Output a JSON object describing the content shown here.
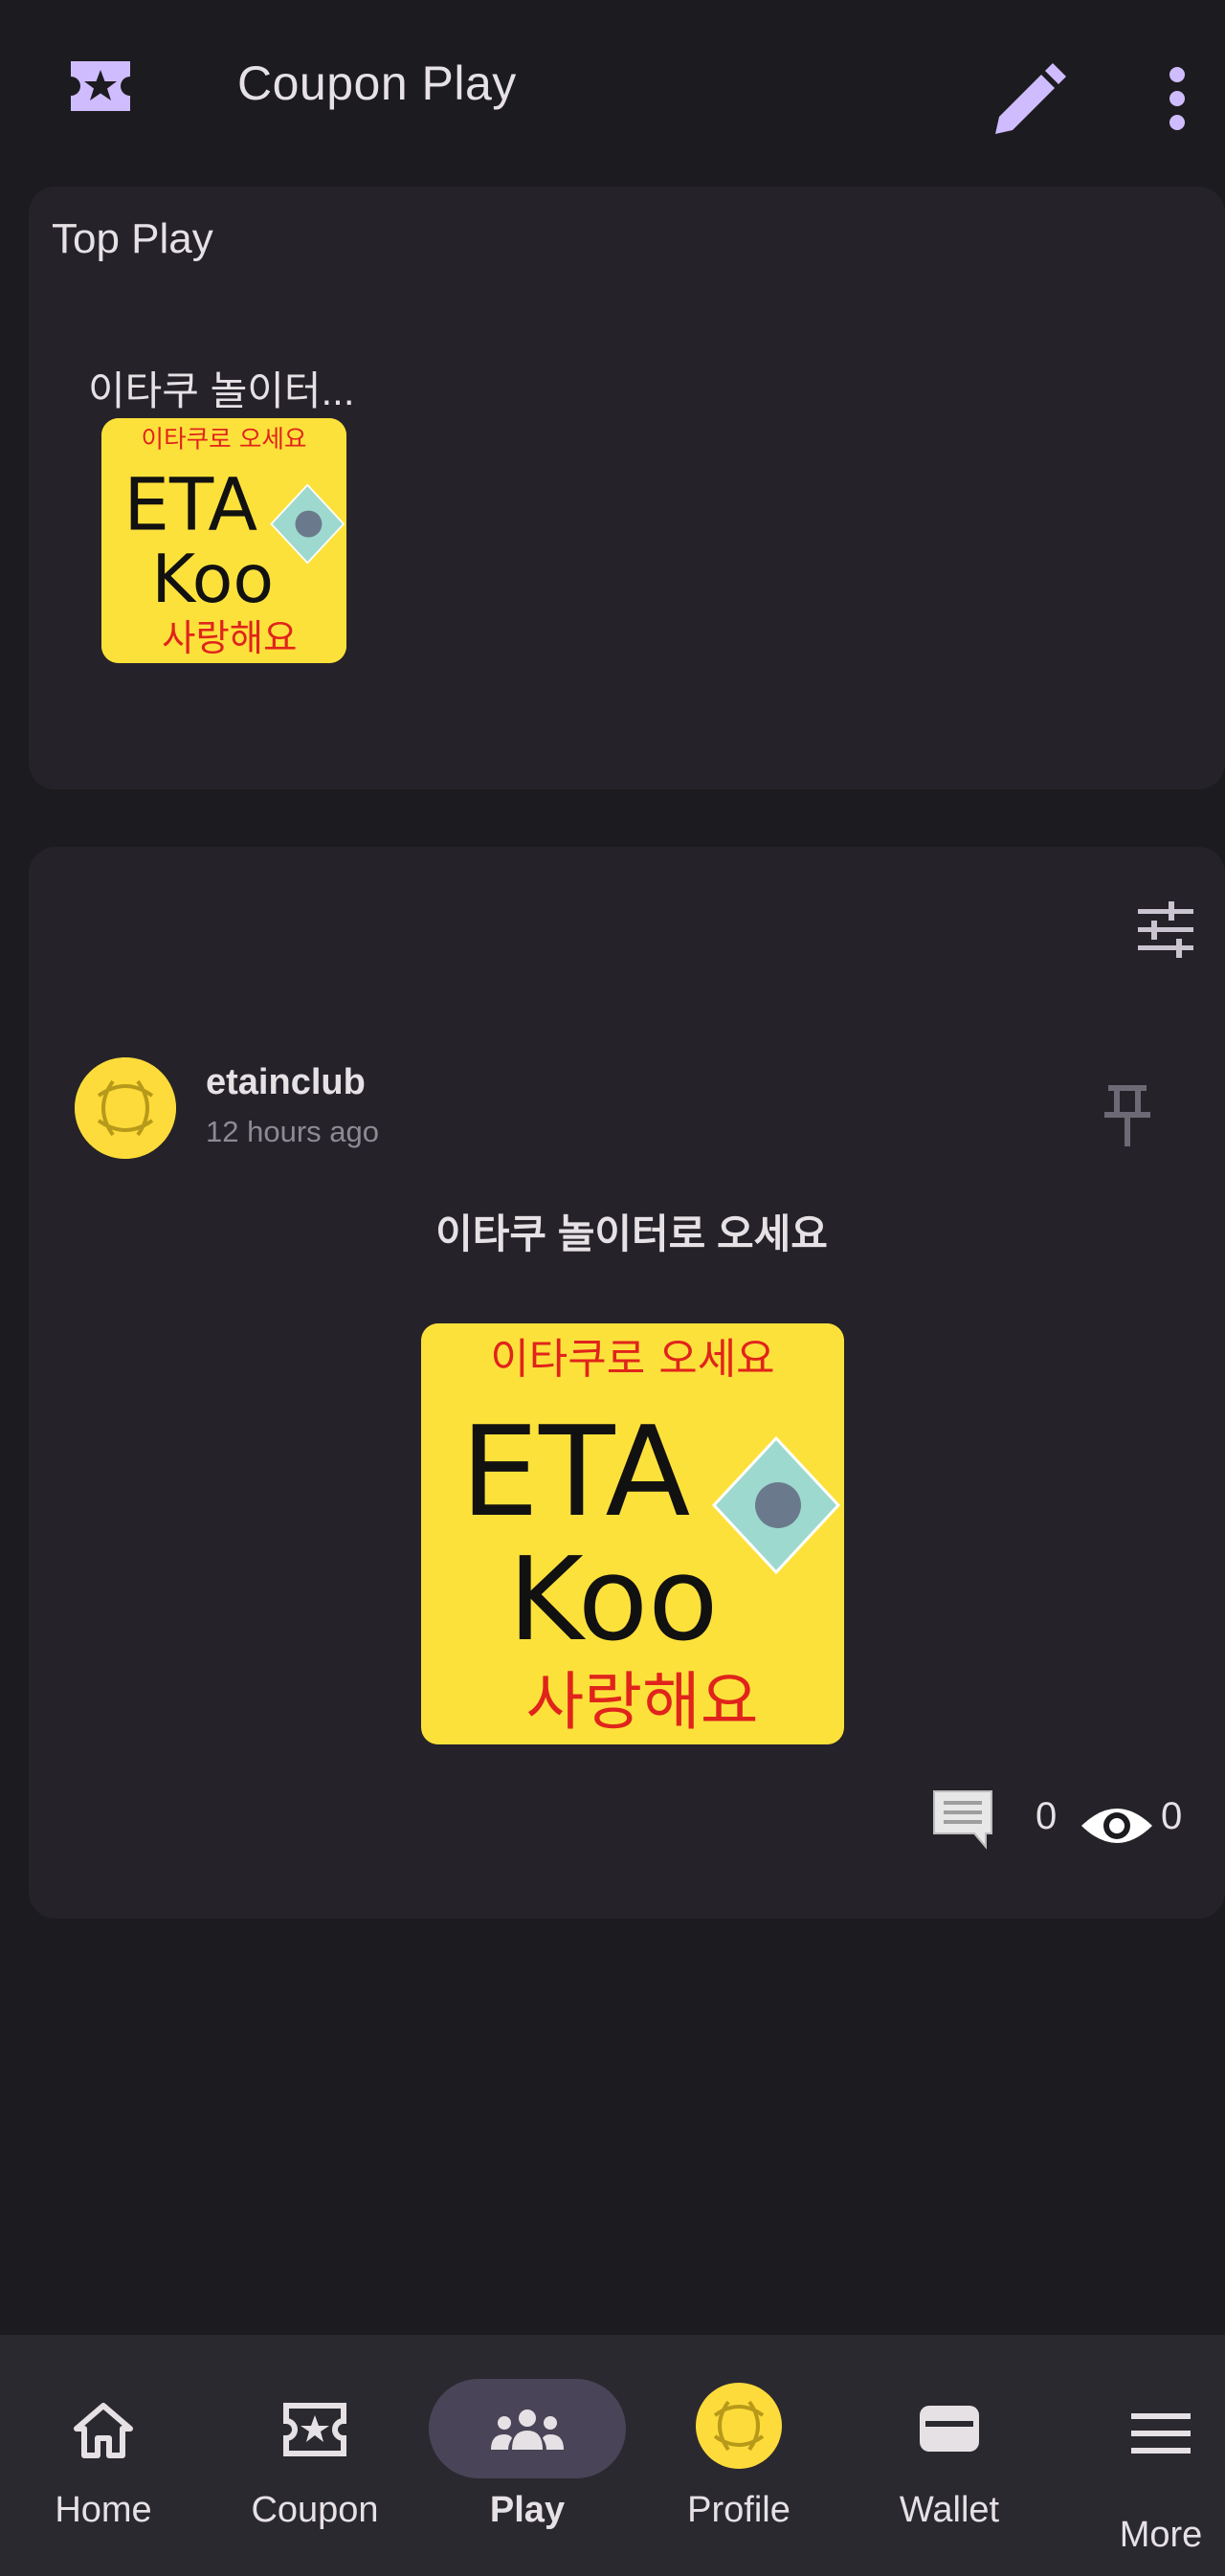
{
  "appbar": {
    "title": "Coupon Play",
    "icon": "coupon-star-icon",
    "accent": "#cfbcff"
  },
  "top_play": {
    "title": "Top Play",
    "items": [
      {
        "title": "이타쿠 놀이터..."
      }
    ]
  },
  "thumbnail_art": {
    "line1": "이타쿠로 오세요",
    "line2": "ETA",
    "line3": "Koo",
    "line4": "사랑해요"
  },
  "feed": {
    "post": {
      "author": "etainclub",
      "timestamp": "12 hours ago",
      "title": "이타쿠 놀이터로 오세요",
      "comment_count": "0",
      "view_count": "0"
    }
  },
  "bottom_nav": {
    "items": [
      {
        "label": "Home",
        "icon": "home-icon"
      },
      {
        "label": "Coupon",
        "icon": "coupon-icon"
      },
      {
        "label": "Play",
        "icon": "group-icon",
        "active": true
      },
      {
        "label": "Profile",
        "icon": "avatar"
      },
      {
        "label": "Wallet",
        "icon": "wallet-icon"
      },
      {
        "label": "More",
        "icon": "menu-icon"
      }
    ]
  }
}
